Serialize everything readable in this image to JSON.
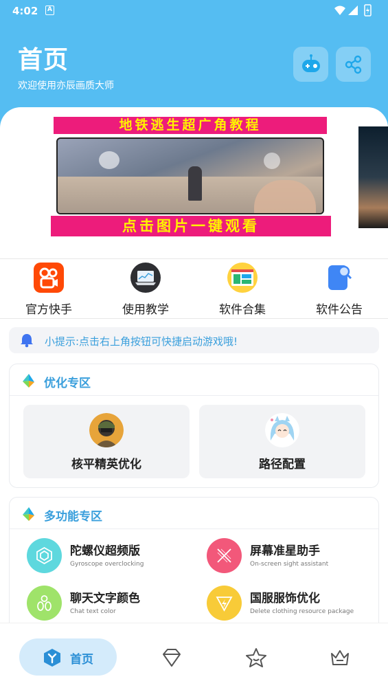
{
  "status_bar": {
    "time": "4:02",
    "notification_icon_letter": "A"
  },
  "header": {
    "title": "首页",
    "subtitle": "欢迎使用亦辰画质大师",
    "buttons": [
      {
        "icon": "game-controller-icon",
        "action": "launch-game"
      },
      {
        "icon": "share-icon",
        "action": "share"
      }
    ],
    "background_color": "#55bdf2"
  },
  "banner": {
    "top_text": "地铁逃生超广角教程",
    "bottom_text": "点击图片一键观看",
    "accent_color": "#ed1c7b",
    "text_color": "#fff200"
  },
  "quick_menu": [
    {
      "label": "官方快手",
      "icon": "kuaishou-icon"
    },
    {
      "label": "使用教学",
      "icon": "laptop-tutorial-icon"
    },
    {
      "label": "软件合集",
      "icon": "app-collection-icon"
    },
    {
      "label": "软件公告",
      "icon": "announcement-icon"
    }
  ],
  "tip": {
    "text": "小提示:点击右上角按钮可快捷启动游戏哦!",
    "icon": "bell-icon"
  },
  "optimize_section": {
    "title": "优化专区",
    "items": [
      {
        "label": "核平精英优化",
        "icon": "peace-elite-avatar"
      },
      {
        "label": "路径配置",
        "icon": "anime-girl-avatar"
      }
    ]
  },
  "multi_section": {
    "title": "多功能专区",
    "items": [
      {
        "title": "陀螺仪超频版",
        "subtitle": "Gyroscope overclocking",
        "color": "#5ed8de",
        "icon": "hexagon-icon"
      },
      {
        "title": "屏幕准星助手",
        "subtitle": "On-screen sight assistant",
        "color": "#f2587a",
        "icon": "crosshair-icon"
      },
      {
        "title": "聊天文字颜色",
        "subtitle": "Chat text color",
        "color": "#9fe36a",
        "icon": "palette-icon"
      },
      {
        "title": "国服服饰优化",
        "subtitle": "Delete clothing resource package",
        "color": "#f8cb38",
        "icon": "lightning-icon"
      }
    ]
  },
  "bottom_nav": {
    "home_label": "首页",
    "items": [
      "diamond-icon",
      "star-icon",
      "crown-icon"
    ],
    "accent_color": "#2b8fd6"
  }
}
